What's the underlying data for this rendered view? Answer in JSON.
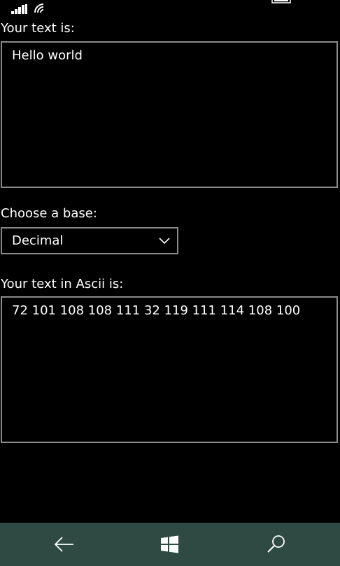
{
  "status_bar": {
    "icons": [
      "signal-strength-icon",
      "wifi-icon",
      "battery-icon"
    ]
  },
  "input_section": {
    "label": "Your text is:",
    "value": "Hello world"
  },
  "base_section": {
    "label": "Choose a base:",
    "selected": "Decimal"
  },
  "output_section": {
    "label": "Your text in Ascii is:",
    "value": "72 101 108 108 111 32 119 111 114 108 100"
  },
  "nav_bar": {
    "color": "#2f4a42",
    "buttons": [
      "back-arrow-icon",
      "windows-logo-icon",
      "search-icon"
    ]
  }
}
